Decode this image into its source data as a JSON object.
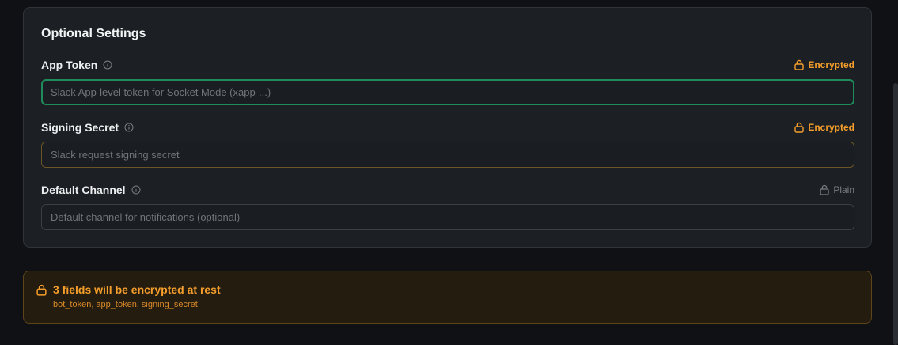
{
  "section": {
    "title": "Optional Settings"
  },
  "fields": [
    {
      "label": "App Token",
      "badge": "Encrypted",
      "placeholder": "Slack App-level token for Socket Mode (xapp-...)",
      "value": ""
    },
    {
      "label": "Signing Secret",
      "badge": "Encrypted",
      "placeholder": "Slack request signing secret",
      "value": ""
    },
    {
      "label": "Default Channel",
      "badge": "Plain",
      "placeholder": "Default channel for notifications (optional)",
      "value": ""
    }
  ],
  "notice": {
    "title": "3 fields will be encrypted at rest",
    "fields_list": "bot_token, app_token, signing_secret"
  },
  "colors": {
    "accent_amber": "#f59e2b",
    "focus_green": "#1f8a5b",
    "card_bg": "#1c1f23",
    "page_bg": "#0f1114"
  },
  "icons": {
    "info": "info-icon",
    "encrypted": "lock-closed-icon",
    "plain": "lock-open-icon"
  }
}
